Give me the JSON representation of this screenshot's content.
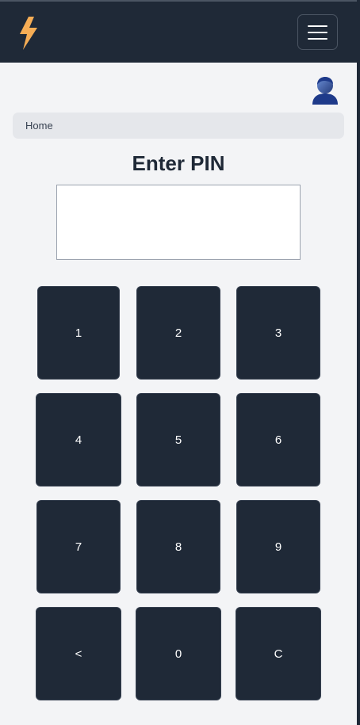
{
  "navbar": {
    "logo_icon": "lightning-bolt-icon",
    "menu_icon": "hamburger-menu-icon",
    "brand_color": "#f6ad55"
  },
  "user": {
    "avatar_icon": "user-avatar-icon"
  },
  "breadcrumb": {
    "home_label": "Home"
  },
  "pin": {
    "title": "Enter PIN",
    "value": ""
  },
  "keypad": {
    "keys": [
      "1",
      "2",
      "3",
      "4",
      "5",
      "6",
      "7",
      "8",
      "9",
      "<",
      "0",
      "C"
    ]
  }
}
